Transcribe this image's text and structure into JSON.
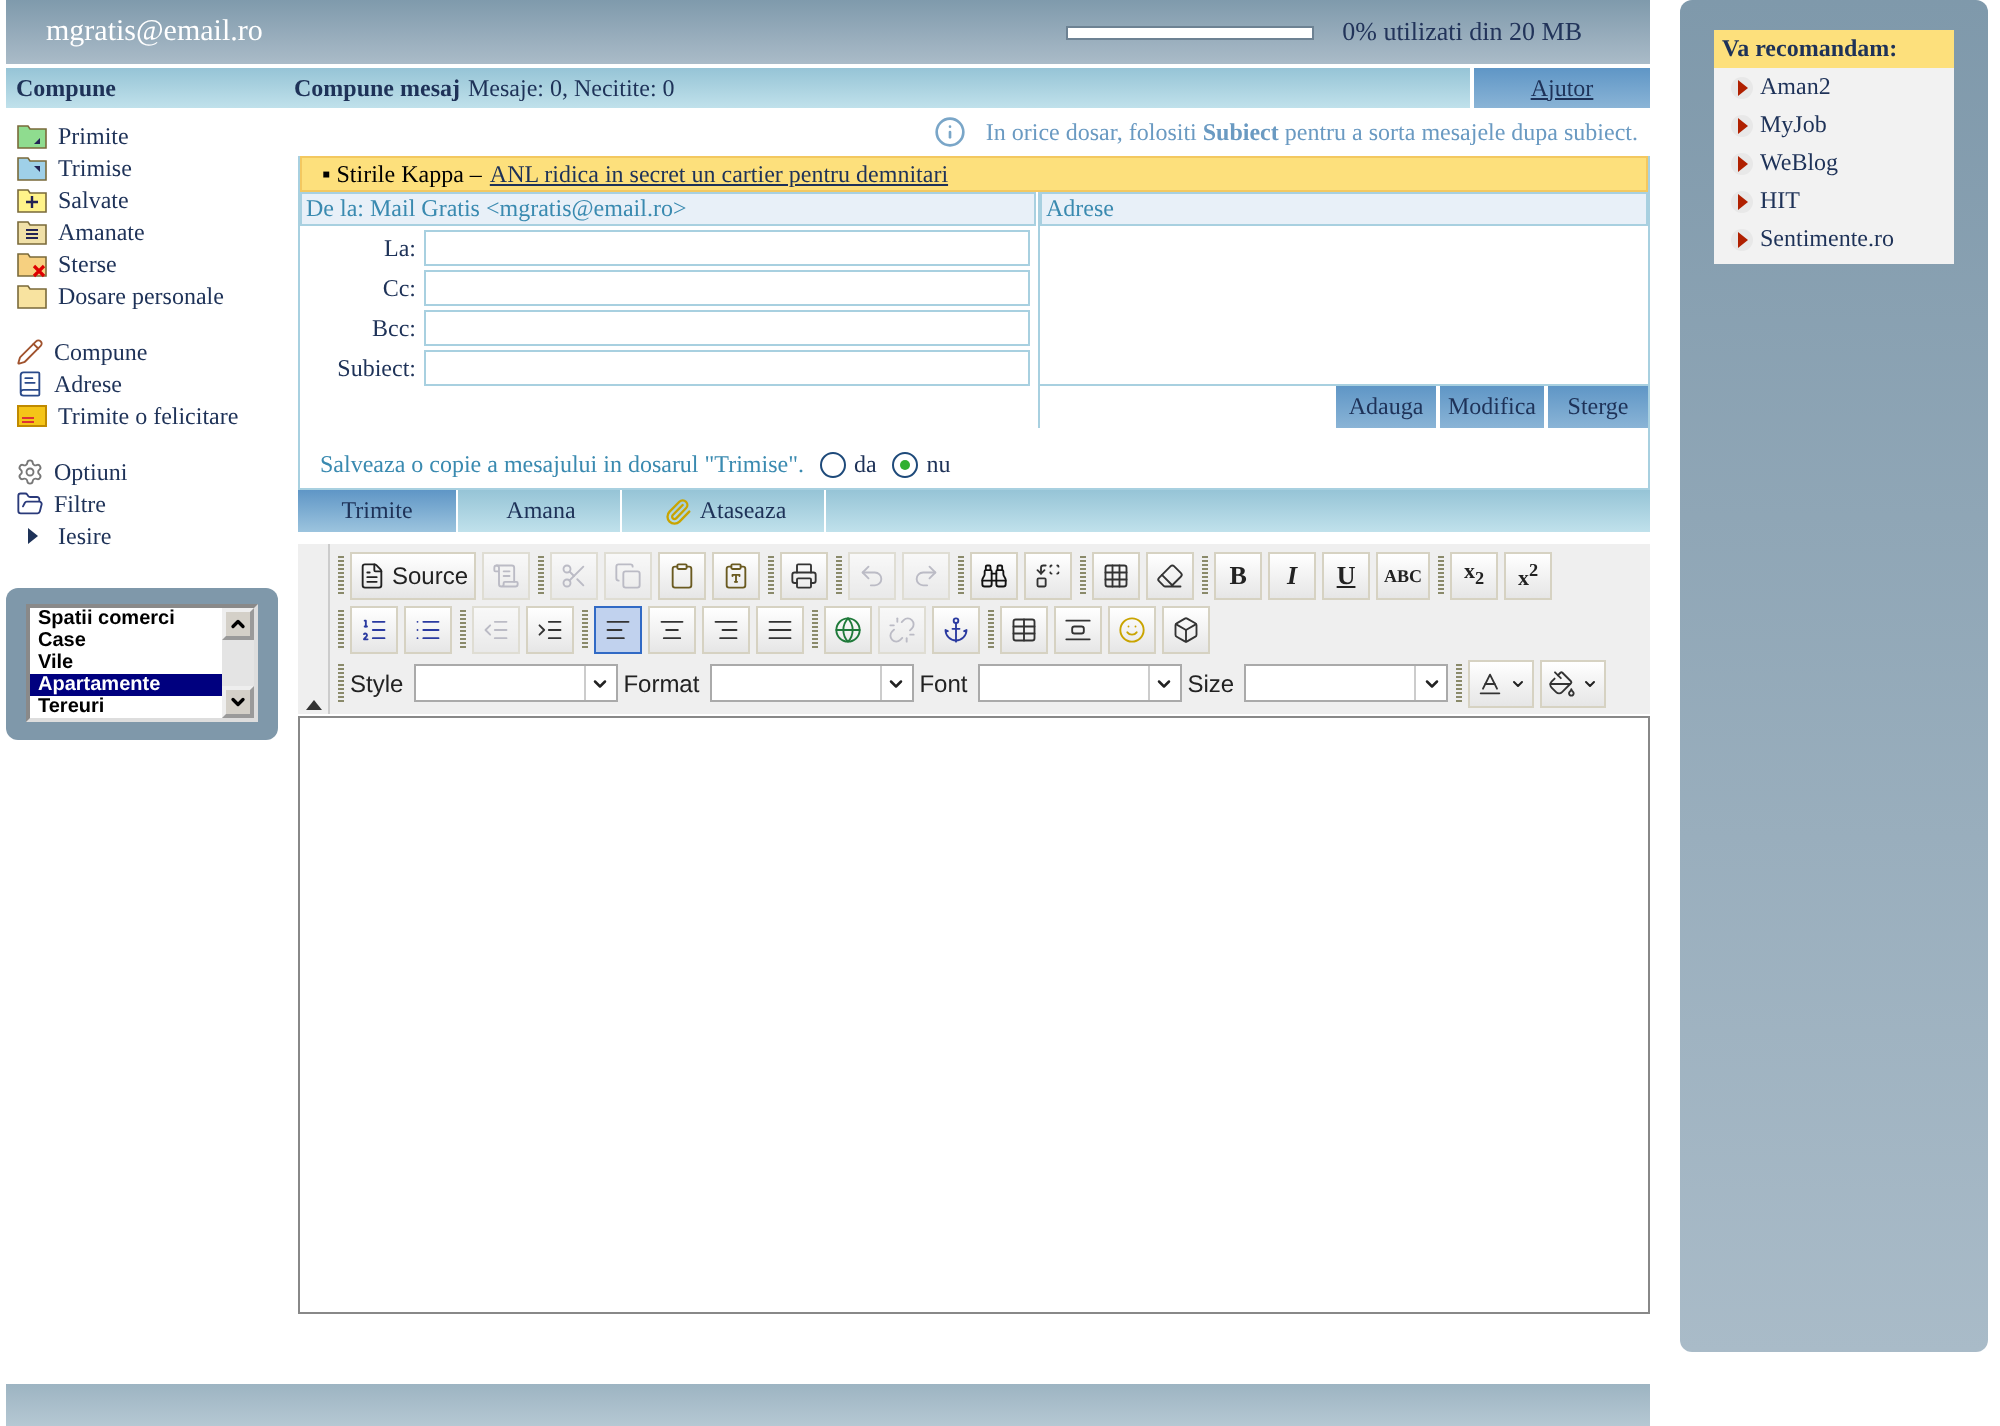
{
  "header": {
    "account": "mgratis@email.ro",
    "quota": {
      "level": 0,
      "label": "0% utilizati din 20 MB"
    }
  },
  "subheader": {
    "section": "Compune",
    "title": "Compune mesaj",
    "counts": "Mesaje: 0, Necitite: 0",
    "help_link": "Ajutor"
  },
  "sidebar": {
    "groups": [
      {
        "items": [
          {
            "kind": "inbox",
            "label": "Primite"
          },
          {
            "kind": "sent",
            "label": "Trimise"
          },
          {
            "kind": "saved",
            "label": "Salvate"
          },
          {
            "kind": "postponed",
            "label": "Amanate"
          },
          {
            "kind": "deleted",
            "label": "Sterse"
          },
          {
            "kind": "folder",
            "label": "Dosare personale"
          }
        ]
      },
      {
        "items": [
          {
            "kind": "compose",
            "label": "Compune"
          },
          {
            "kind": "addresses",
            "label": "Adrese"
          },
          {
            "kind": "card",
            "label": "Trimite o felicitare"
          }
        ]
      },
      {
        "items": [
          {
            "kind": "options",
            "label": "Optiuni"
          },
          {
            "kind": "filters",
            "label": "Filtre"
          },
          {
            "kind": "exit",
            "label": "Iesire"
          }
        ]
      }
    ]
  },
  "listbox": {
    "items": [
      {
        "label": "Spatii comerci",
        "selected": false
      },
      {
        "label": "Case",
        "selected": false
      },
      {
        "label": "Vile",
        "selected": false
      },
      {
        "label": "Apartamente",
        "selected": true
      },
      {
        "label": "Tereuri",
        "selected": false
      }
    ]
  },
  "tip": "In orice dosar, folositi **Subiect** pentru a sorta mesajele dupa subiect.",
  "news": {
    "source": "▪ Stirile Kappa –",
    "link": "ANL ridica in secret un cartier pentru demnitari"
  },
  "form": {
    "from": "De la: Mail Gratis <mgratis@email.ro>",
    "fields": [
      {
        "label": "La:"
      },
      {
        "label": "Cc:"
      },
      {
        "label": "Bcc:"
      },
      {
        "label": "Subiect:"
      }
    ]
  },
  "addresses": {
    "title": "Adrese",
    "buttons": [
      "Adauga",
      "Modifica",
      "Sterge"
    ]
  },
  "save_copy": {
    "label": "Salveaza o copie a mesajului in dosarul \"Trimise\".",
    "options": [
      {
        "label": "da",
        "selected": false
      },
      {
        "label": "nu",
        "selected": true
      }
    ]
  },
  "tabs": [
    {
      "label": "Trimite",
      "selected": true,
      "kind": "plain"
    },
    {
      "label": "Amana",
      "selected": false,
      "kind": "plain"
    },
    {
      "label": "Ataseaza",
      "selected": false,
      "kind": "attach"
    }
  ],
  "toolbar": {
    "rows": [
      {
        "groups": [
          {
            "tools": [
              {
                "kind": "source",
                "label": "Source",
                "disabled": false
              },
              {
                "kind": "preview",
                "disabled": true
              }
            ]
          },
          {
            "tools": [
              {
                "kind": "cut",
                "disabled": true
              },
              {
                "kind": "copy",
                "disabled": true
              },
              {
                "kind": "paste",
                "disabled": false
              },
              {
                "kind": "pastetext",
                "disabled": false
              }
            ]
          },
          {
            "tools": [
              {
                "kind": "print",
                "disabled": false
              }
            ]
          },
          {
            "tools": [
              {
                "kind": "undo",
                "disabled": true
              },
              {
                "kind": "redo",
                "disabled": true
              }
            ]
          },
          {
            "tools": [
              {
                "kind": "find",
                "disabled": false
              },
              {
                "kind": "replace",
                "disabled": false
              }
            ]
          },
          {
            "tools": [
              {
                "kind": "selectall",
                "disabled": false
              },
              {
                "kind": "eraser",
                "disabled": false
              }
            ]
          },
          {
            "tools": [
              {
                "kind": "bold",
                "label": "B",
                "disabled": false
              },
              {
                "kind": "italic",
                "label": "I",
                "disabled": false
              },
              {
                "kind": "underline",
                "label": "U",
                "disabled": false
              },
              {
                "kind": "strike",
                "label": "ABC",
                "disabled": false
              }
            ]
          },
          {
            "tools": [
              {
                "kind": "script",
                "label": "x$_{2}$",
                "disabled": false
              },
              {
                "kind": "script",
                "label": "x$^{2}$",
                "disabled": false
              }
            ]
          }
        ]
      },
      {
        "groups": [
          {
            "tools": [
              {
                "kind": "ol",
                "disabled": false
              },
              {
                "kind": "ul",
                "disabled": false
              }
            ]
          },
          {
            "tools": [
              {
                "kind": "outdent",
                "disabled": true
              },
              {
                "kind": "indent",
                "disabled": false
              }
            ]
          },
          {
            "tools": [
              {
                "kind": "alignleft",
                "disabled": false,
                "selected": true
              },
              {
                "kind": "aligncenter",
                "disabled": false,
                "selected": false
              },
              {
                "kind": "alignright",
                "disabled": false,
                "selected": false
              },
              {
                "kind": "justify",
                "disabled": false,
                "selected": false
              }
            ]
          },
          {
            "tools": [
              {
                "kind": "link",
                "disabled": false
              },
              {
                "kind": "unlink",
                "disabled": true
              },
              {
                "kind": "anchor",
                "disabled": false
              }
            ]
          },
          {
            "tools": [
              {
                "kind": "table",
                "disabled": false
              },
              {
                "kind": "rule",
                "disabled": false
              },
              {
                "kind": "smiley",
                "disabled": false
              },
              {
                "kind": "special",
                "disabled": false
              }
            ]
          }
        ]
      },
      {
        "groups": [
          {
            "tools": [
              {
                "kind": "combo",
                "label": "Style"
              },
              {
                "kind": "combo",
                "label": "Format"
              },
              {
                "kind": "combo",
                "label": "Font"
              },
              {
                "kind": "combo",
                "label": "Size"
              }
            ]
          },
          {
            "tools": [
              {
                "kind": "textcolor",
                "disabled": false
              },
              {
                "kind": "bgcolor",
                "disabled": false
              }
            ]
          }
        ]
      }
    ]
  },
  "recommend": {
    "title": "Va recomandam:",
    "items": [
      "Aman2",
      "MyJob",
      "WeBlog",
      "HIT",
      "Sentimente.ro"
    ]
  }
}
